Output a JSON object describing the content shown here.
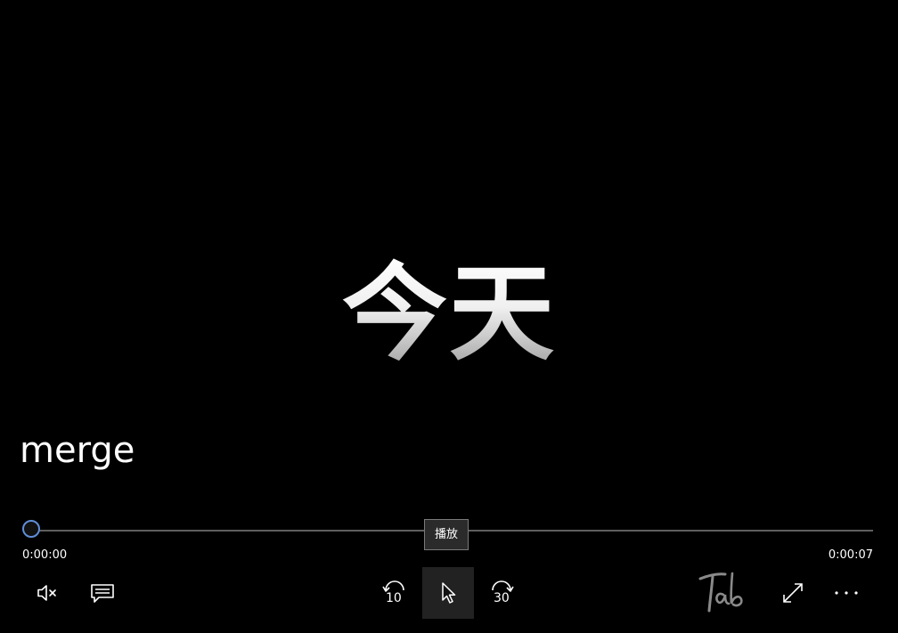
{
  "video": {
    "caption": "今天",
    "media_title": "merge"
  },
  "seekbar": {
    "elapsed": "0:00:00",
    "total": "0:00:07",
    "progress": 0
  },
  "tooltip": {
    "label": "播放"
  },
  "controls": {
    "mute_icon": "volume-muted-icon",
    "subtitles_icon": "subtitles-icon",
    "skip_back_seconds": "10",
    "play_icon": "play-icon",
    "skip_forward_seconds": "30",
    "fullscreen_icon": "fullscreen-icon",
    "more_icon": "more-options-icon"
  },
  "colors": {
    "accent": "#5f8ed8",
    "track": "#5f5f5f",
    "background": "#000000"
  }
}
